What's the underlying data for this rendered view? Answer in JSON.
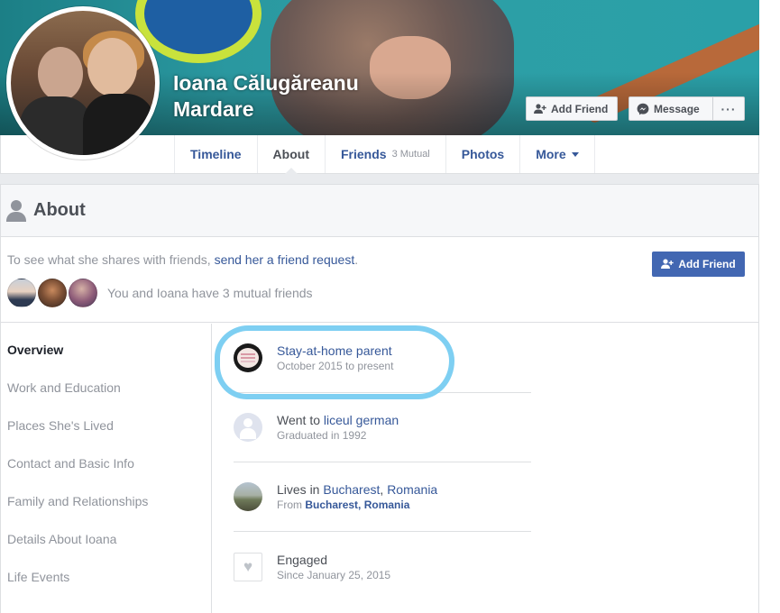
{
  "profile": {
    "name_line1": "Ioana Călugăreanu",
    "name_line2": "Mardare"
  },
  "cover_actions": {
    "add_friend": "Add Friend",
    "message": "Message",
    "more": "···"
  },
  "nav": {
    "tabs": [
      {
        "label": "Timeline",
        "sub": ""
      },
      {
        "label": "About",
        "sub": ""
      },
      {
        "label": "Friends",
        "sub": "3 Mutual"
      },
      {
        "label": "Photos",
        "sub": ""
      },
      {
        "label": "More",
        "sub": ""
      }
    ],
    "active_tab": "About"
  },
  "about": {
    "title": "About",
    "prompt_prefix": "To see what she shares with friends, ",
    "prompt_link": "send her a friend request",
    "prompt_suffix": ".",
    "mutual_text": "You and Ioana have 3 mutual friends",
    "add_friend": "Add Friend",
    "sections": [
      "Overview",
      "Work and Education",
      "Places She's Lived",
      "Contact and Basic Info",
      "Family and Relationships",
      "Details About Ioana",
      "Life Events"
    ],
    "overview": {
      "work": {
        "title": "Stay-at-home parent",
        "sub": "October 2015 to present"
      },
      "education": {
        "prefix": "Went to ",
        "link": "liceul german",
        "sub": "Graduated in 1992"
      },
      "lives": {
        "prefix": "Lives in ",
        "city": "Bucharest",
        "sep": ", ",
        "country": "Romania",
        "from_label": "From ",
        "from_value": "Bucharest, Romania"
      },
      "relationship": {
        "title": "Engaged",
        "sub": "Since January 25, 2015"
      }
    }
  },
  "colors": {
    "link": "#365899",
    "button_blue": "#4267b2",
    "highlight_circle": "#7ecff2"
  }
}
